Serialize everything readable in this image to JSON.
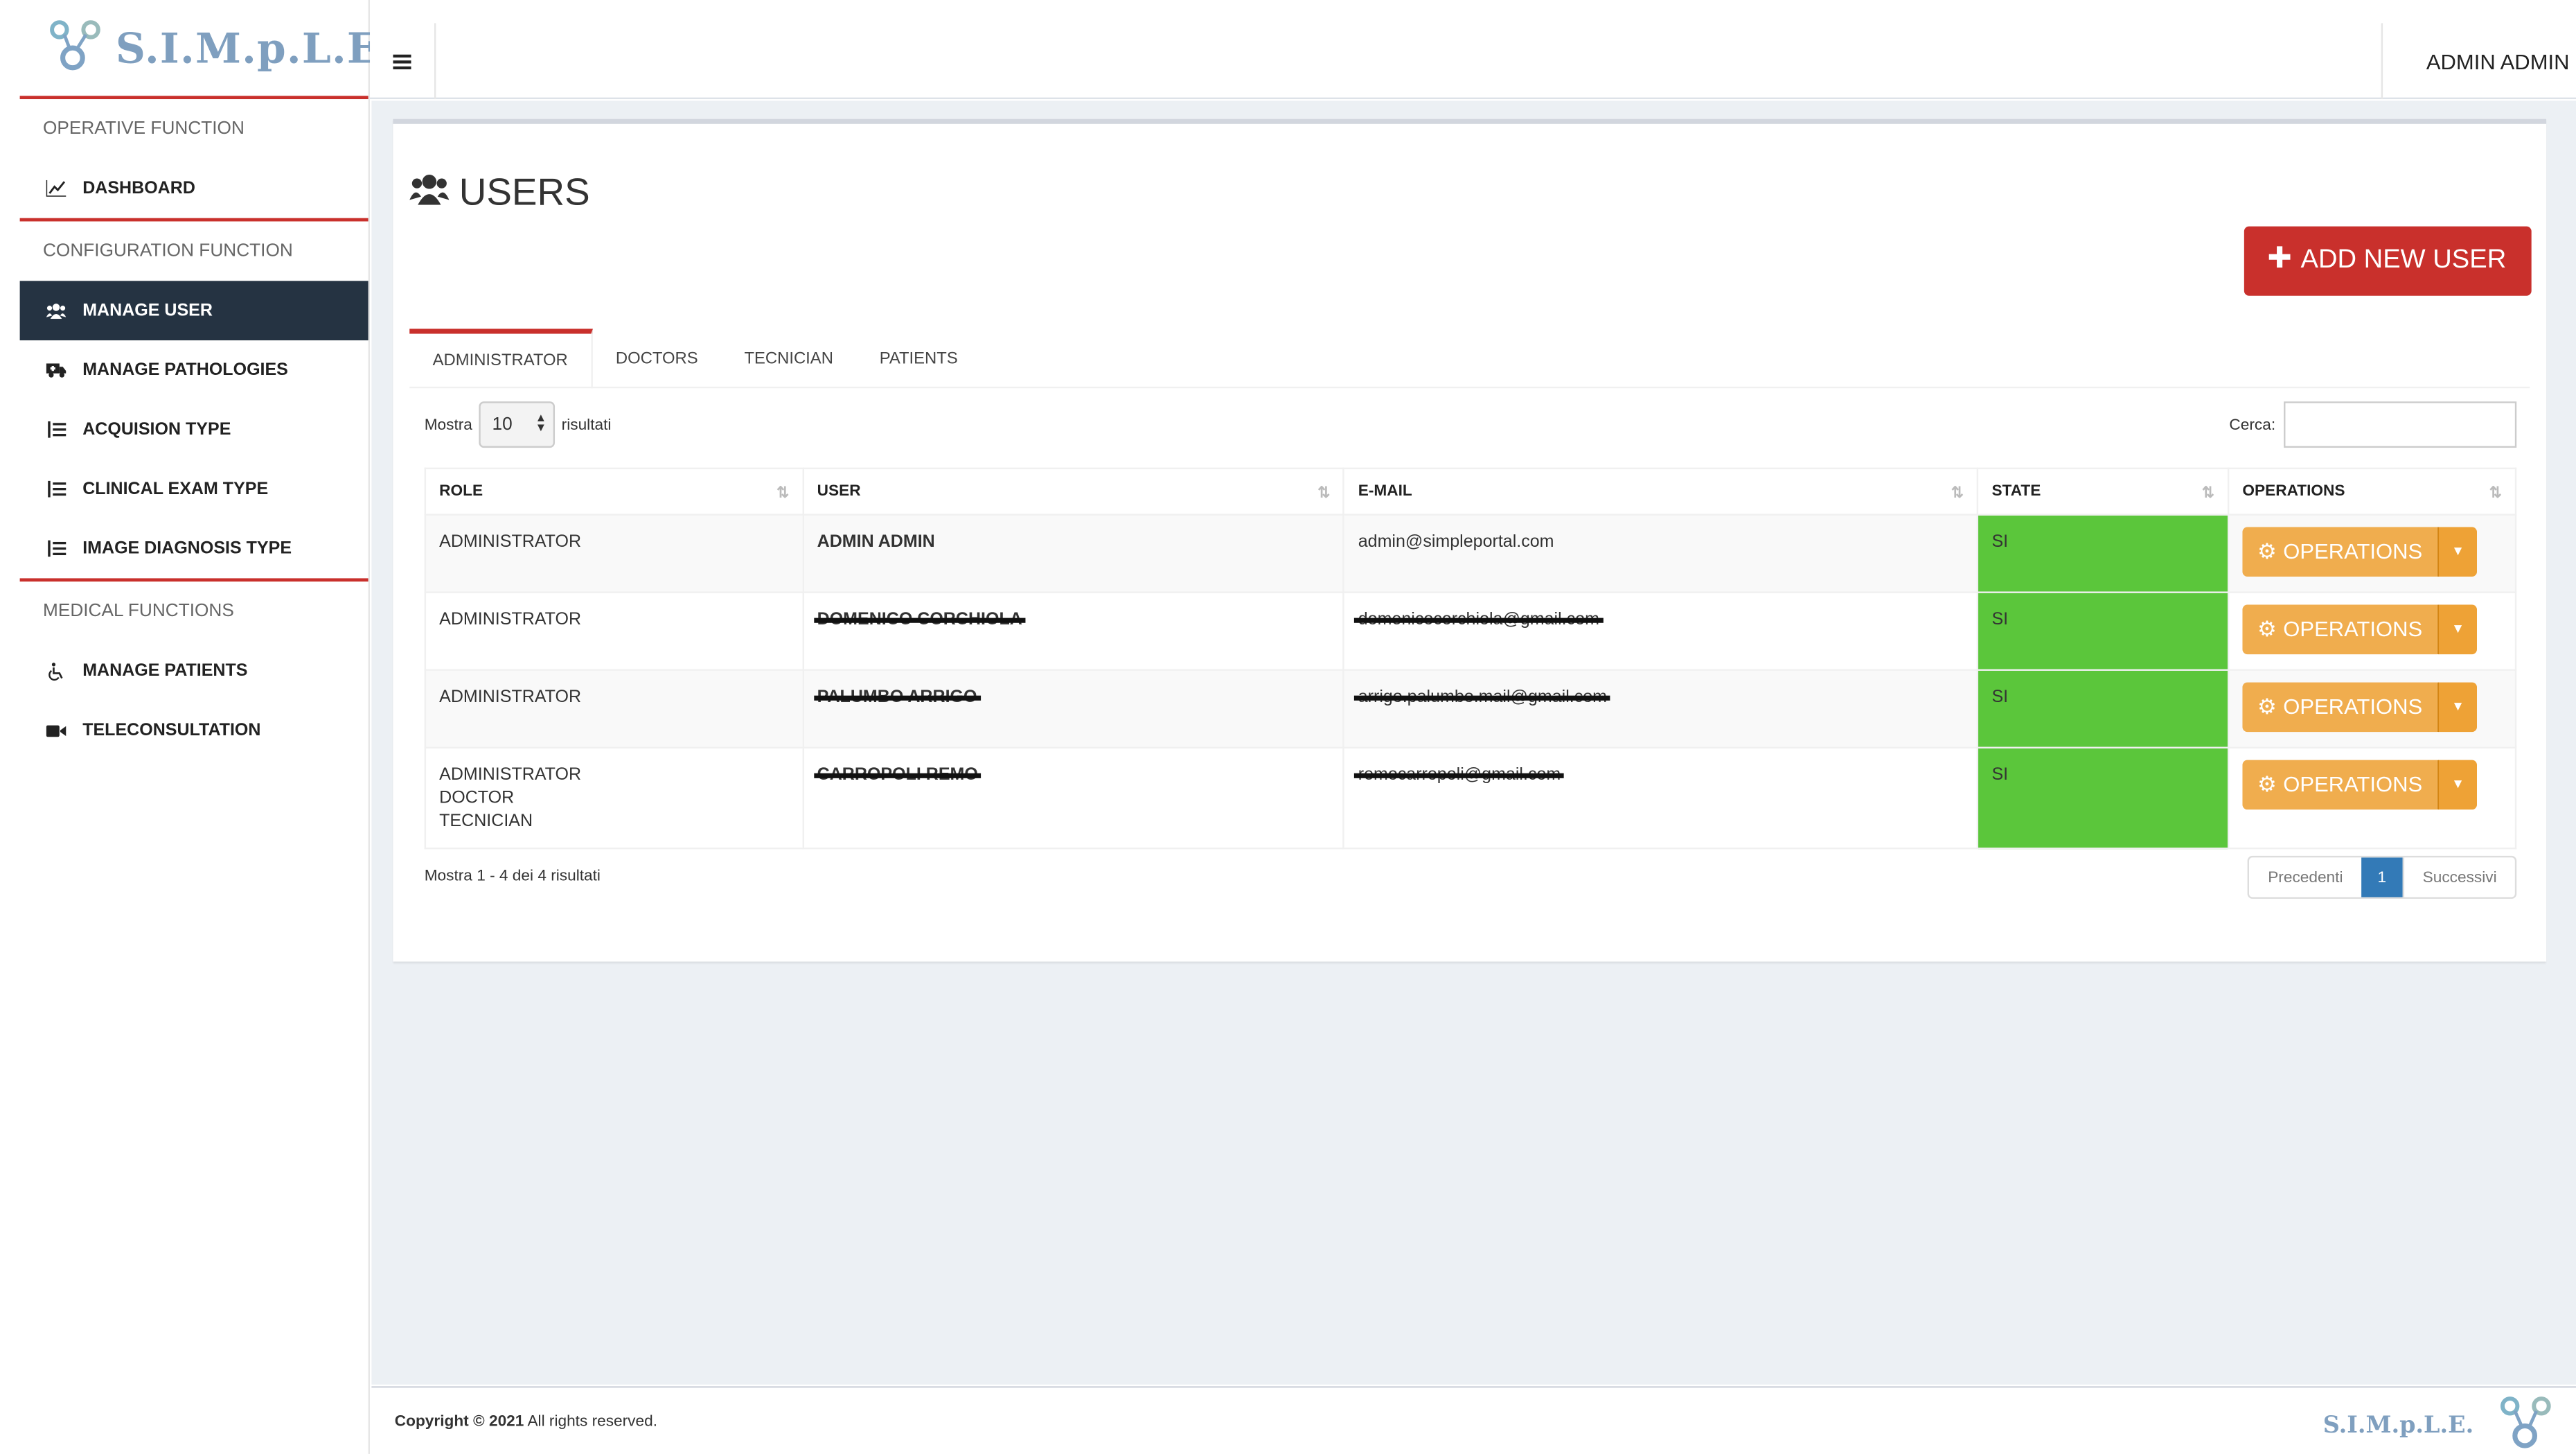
{
  "app": {
    "brand": "S.I.M.p.L.E.",
    "user_name": "ADMIN ADMIN"
  },
  "sidebar": {
    "sections": [
      {
        "title": "OPERATIVE FUNCTION",
        "items": [
          {
            "label": "DASHBOARD",
            "icon": "line-chart-icon"
          }
        ]
      },
      {
        "title": "CONFIGURATION FUNCTION",
        "items": [
          {
            "label": "MANAGE USER",
            "icon": "users-icon",
            "active": true
          },
          {
            "label": "MANAGE PATHOLOGIES",
            "icon": "ambulance-icon"
          },
          {
            "label": "ACQUISION TYPE",
            "icon": "list-icon"
          },
          {
            "label": "CLINICAL EXAM TYPE",
            "icon": "list-icon"
          },
          {
            "label": "IMAGE DIAGNOSIS TYPE",
            "icon": "list-icon"
          }
        ]
      },
      {
        "title": "MEDICAL FUNCTIONS",
        "items": [
          {
            "label": "MANAGE PATIENTS",
            "icon": "wheelchair-icon"
          },
          {
            "label": "TELECONSULTATION",
            "icon": "video-camera-icon"
          }
        ]
      }
    ]
  },
  "main": {
    "title": "USERS",
    "add_button": "ADD NEW USER",
    "tabs": [
      "ADMINISTRATOR",
      "DOCTORS",
      "TECNICIAN",
      "PATIENTS"
    ],
    "active_tab": "ADMINISTRATOR",
    "length": {
      "prefix": "Mostra",
      "value": "10",
      "suffix": "risultati"
    },
    "search": {
      "label": "Cerca:",
      "value": ""
    },
    "table": {
      "columns": [
        "ROLE",
        "USER",
        "E-MAIL",
        "STATE",
        "OPERATIONS"
      ],
      "rows": [
        {
          "role": [
            "ADMINISTRATOR"
          ],
          "user": "ADMIN ADMIN",
          "email": "admin@simpleportal.com",
          "state": "SI",
          "operations": "OPERATIONS",
          "redacted": false
        },
        {
          "role": [
            "ADMINISTRATOR"
          ],
          "user": "DOMENICO CORCHIOLA",
          "email": "domenicocorchiola@gmail.com",
          "state": "SI",
          "operations": "OPERATIONS",
          "redacted": true
        },
        {
          "role": [
            "ADMINISTRATOR"
          ],
          "user": "PALUMBO ARRIGO",
          "email": "arrigo.palumbo.mail@gmail.com",
          "state": "SI",
          "operations": "OPERATIONS",
          "redacted": true
        },
        {
          "role": [
            "ADMINISTRATOR",
            "DOCTOR",
            "TECNICIAN"
          ],
          "user": "CARROPOLI REMO",
          "email": "remocarropoli@gmail.com",
          "state": "SI",
          "operations": "OPERATIONS",
          "redacted": true
        }
      ]
    },
    "info": "Mostra 1 - 4 dei 4 risultati",
    "pagination": {
      "prev": "Precedenti",
      "current": "1",
      "next": "Successivi"
    }
  },
  "footer": {
    "copyright_bold": "Copyright © 2021",
    "copyright_rest": " All rights reserved.",
    "brand": "S.I.M.p.L.E."
  },
  "colors": {
    "accent_red": "#c9302c",
    "sidebar_active": "#253342",
    "state_green": "#5bc63b",
    "operations_orange": "#f0ad4e",
    "pager_blue": "#337ab7",
    "brand_blue": "#7f9fbf"
  }
}
